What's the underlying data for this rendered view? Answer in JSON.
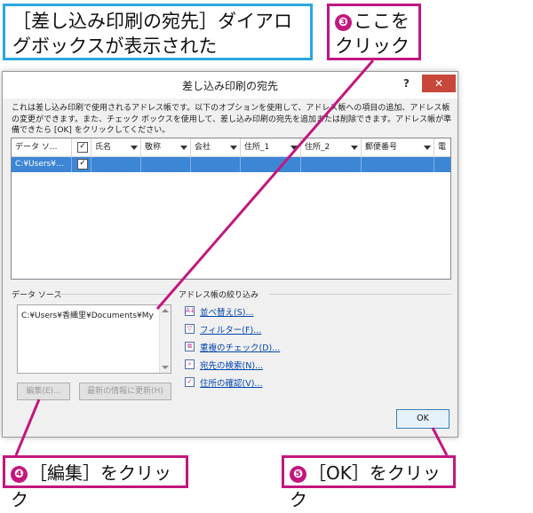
{
  "callouts": {
    "top_left": "［差し込み印刷の宛先］ダイアログボックスが表示された",
    "step3_num": "❸",
    "step3": "ここをクリック",
    "step4_num": "❹",
    "step4": "［編集］をクリック",
    "step5_num": "❺",
    "step5": "［OK］をクリック"
  },
  "dialog": {
    "title": "差し込み印刷の宛先",
    "help": "?",
    "close": "✕",
    "description": "これは差し込み印刷で使用されるアドレス帳です。以下のオプションを使用して、アドレス帳への項目の追加、アドレス帳の変更ができます。また、チェック ボックスを使用して、差し込み印刷の宛先を追加または削除できます。アドレス帳が準備できたら [OK] をクリックしてください。",
    "columns": [
      "データ ソ...",
      "",
      "氏名",
      "敬称",
      "会社",
      "住所_1",
      "住所_2",
      "郵便番号",
      "電"
    ],
    "row": {
      "source": "C:¥Users¥...",
      "check": "✓"
    },
    "header_check": "✓",
    "data_source_label": "データ ソース",
    "data_source_item": "C:¥Users¥香織里¥Documents¥My",
    "filter_label": "アドレス帳の絞り込み",
    "links": [
      {
        "icon": "A↓",
        "label": "並べ替え(S)..."
      },
      {
        "icon": "▽",
        "label": "フィルター(F)..."
      },
      {
        "icon": "⧉",
        "label": "重複のチェック(D)..."
      },
      {
        "icon": "⌕",
        "label": "宛先の検索(N)..."
      },
      {
        "icon": "✓",
        "label": "住所の確認(V)..."
      }
    ],
    "edit_button": "編集(E)...",
    "refresh_button": "最新の情報に更新(H)",
    "ok_button": "OK"
  },
  "colors": {
    "blue_border": "#29a7e0",
    "pink_border": "#c2177f",
    "selected_row": "#3d86d6",
    "close_button": "#c7473a"
  }
}
